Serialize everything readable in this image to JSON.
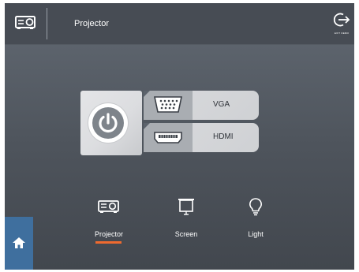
{
  "header": {
    "title": "Projector",
    "device_icon": "projector-icon",
    "exit_icon": "exit-icon",
    "exit_label": "EXIT DEMO"
  },
  "power": {
    "icon": "power-icon"
  },
  "sources": [
    {
      "label": "VGA",
      "icon": "vga-port-icon"
    },
    {
      "label": "HDMI",
      "icon": "hdmi-port-icon"
    }
  ],
  "nav": [
    {
      "label": "Projector",
      "icon": "projector-icon",
      "selected": true
    },
    {
      "label": "Screen",
      "icon": "screen-icon",
      "selected": false
    },
    {
      "label": "Light",
      "icon": "lightbulb-icon",
      "selected": false
    }
  ],
  "home": {
    "icon": "home-icon"
  },
  "colors": {
    "accent": "#ef6a2f",
    "home_bg": "#3f6f9e",
    "background": "#4a4f57"
  }
}
